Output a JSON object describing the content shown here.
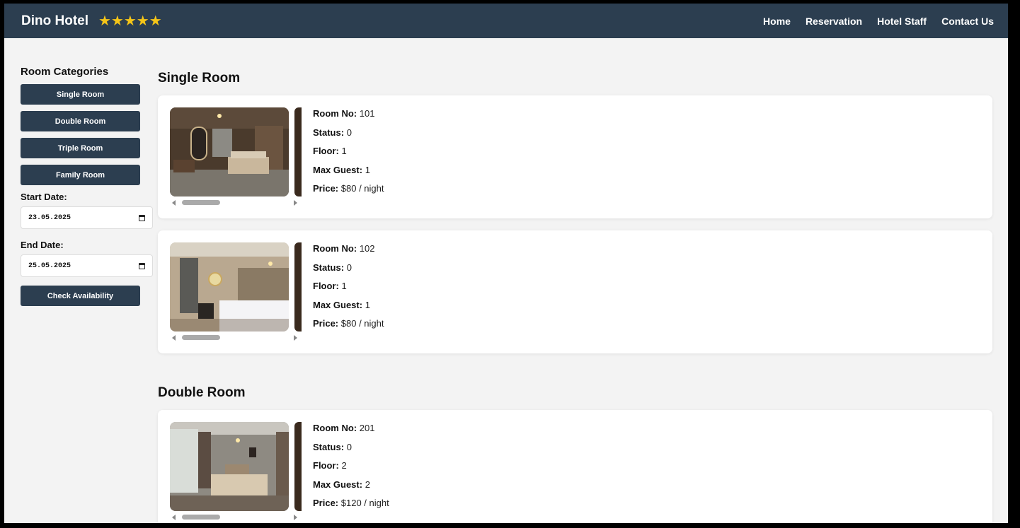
{
  "header": {
    "brand": "Dino Hotel",
    "stars": "★★★★★",
    "nav": [
      "Home",
      "Reservation",
      "Hotel Staff",
      "Contact Us"
    ]
  },
  "sidebar": {
    "heading": "Room Categories",
    "categories": [
      "Single Room",
      "Double Room",
      "Triple Room",
      "Family Room"
    ],
    "start_label": "Start Date:",
    "start_value": "23.05.2025",
    "end_label": "End Date:",
    "end_value": "25.05.2025",
    "check_button": "Check Availability"
  },
  "labels": {
    "room_no": "Room No:",
    "status": "Status:",
    "floor": "Floor:",
    "max_guest": "Max Guest:",
    "price": "Price:"
  },
  "sections": [
    {
      "title": "Single Room",
      "rooms": [
        {
          "room_no": "101",
          "status": "0",
          "floor": "1",
          "max_guest": "1",
          "price": "$80 / night"
        },
        {
          "room_no": "102",
          "status": "0",
          "floor": "1",
          "max_guest": "1",
          "price": "$80 / night"
        }
      ]
    },
    {
      "title": "Double Room",
      "rooms": [
        {
          "room_no": "201",
          "status": "0",
          "floor": "2",
          "max_guest": "2",
          "price": "$120 / night"
        }
      ]
    }
  ],
  "colors": {
    "navbar": "#2c3e50",
    "button": "#2c3e50",
    "stars": "#f5c518",
    "page_bg": "#f3f3f3"
  }
}
